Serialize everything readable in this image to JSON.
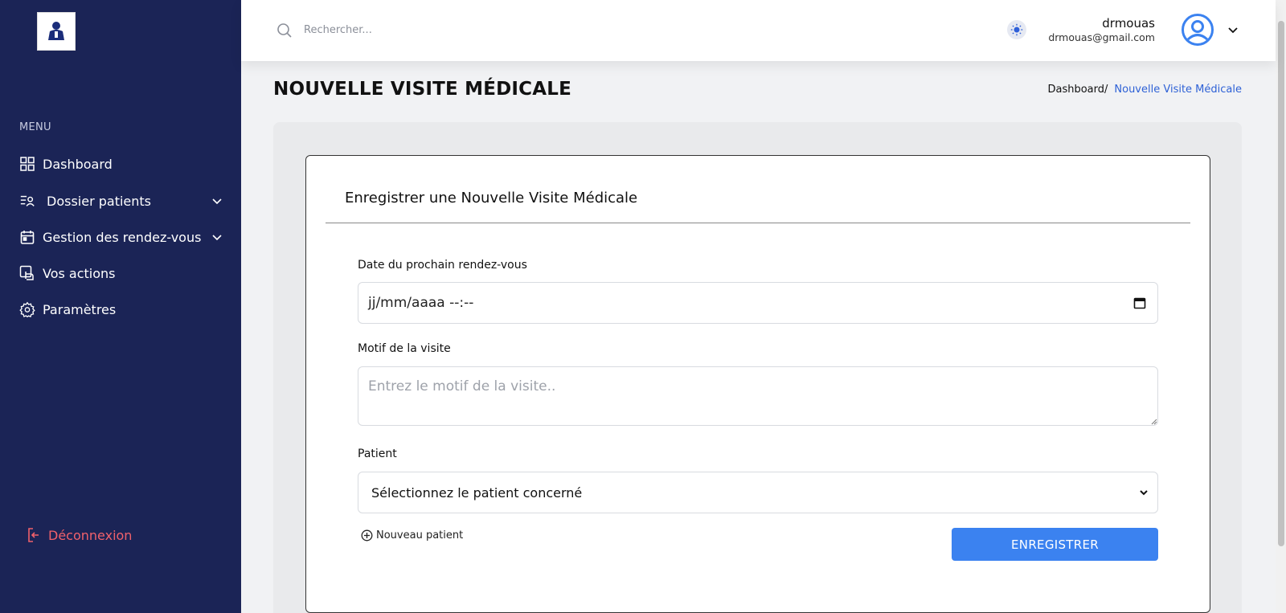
{
  "sidebar": {
    "logo_alt": "DOC",
    "menu_label": "MENU",
    "items": [
      {
        "label": "Dashboard",
        "icon": "grid-icon"
      },
      {
        "label": "Dossier patients",
        "icon": "user-list-icon",
        "has_submenu": true
      },
      {
        "label": "Gestion des rendez-vous",
        "icon": "calendar-icon",
        "has_submenu": true
      },
      {
        "label": "Vos actions",
        "icon": "touch-icon"
      },
      {
        "label": "Paramètres",
        "icon": "gear-icon"
      }
    ],
    "logout_label": "Déconnexion"
  },
  "header": {
    "search_placeholder": "Rechercher...",
    "user_name": "drmouas",
    "user_email": "drmouas@gmail.com"
  },
  "page": {
    "title": "NOUVELLE VISITE MÉDICALE",
    "breadcrumb_home": "Dashboard/",
    "breadcrumb_current": "Nouvelle Visite Médicale"
  },
  "form": {
    "title": "Enregistrer une Nouvelle Visite Médicale",
    "date_label": "Date du prochain rendez-vous",
    "date_value": "jj/mm/aaaa --:--",
    "motif_label": "Motif de la visite",
    "motif_placeholder": "Entrez le motif de la visite..",
    "patient_label": "Patient",
    "patient_selected": "Sélectionnez le patient concerné",
    "new_patient_label": "Nouveau patient",
    "submit_label": "ENREGISTRER"
  },
  "colors": {
    "sidebar_bg": "#1b2456",
    "accent": "#3b82f0",
    "logout": "#f0616b",
    "breadcrumb_active": "#2e61d6"
  }
}
